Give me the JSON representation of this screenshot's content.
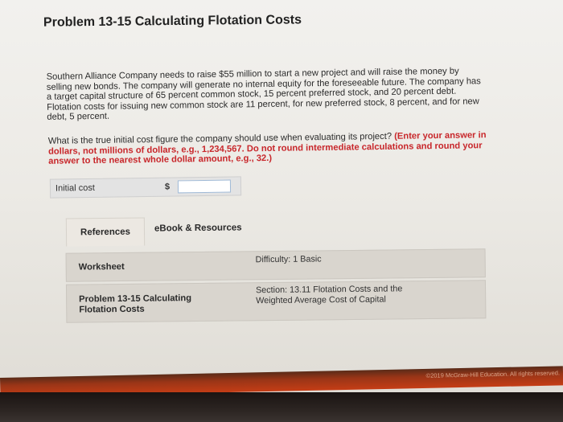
{
  "page": {
    "title": "Problem 13-15 Calculating Flotation Costs"
  },
  "problem": {
    "text": "Southern Alliance Company needs to raise $55 million to start a new project and will raise the money by selling new bonds. The company will generate no internal equity for the foreseeable future. The company has a target capital structure of 65 percent common stock, 15 percent preferred stock, and 20 percent debt. Flotation costs for issuing new common stock are 11 percent, for new preferred stock, 8 percent, and for new debt, 5 percent.",
    "question": "What is the true initial cost figure the company should use when evaluating its project?",
    "instructions": "(Enter your answer in dollars, not millions of dollars, e.g., 1,234,567. Do not round intermediate calculations and round your answer to the nearest whole dollar amount, e.g., 32.)"
  },
  "answer": {
    "label": "Initial cost",
    "currency": "$",
    "value": ""
  },
  "tabs": [
    {
      "label": "References",
      "active": true
    },
    {
      "label": "eBook & Resources",
      "active": false
    }
  ],
  "references": [
    {
      "left": "Worksheet",
      "right": "Difficulty: 1 Basic"
    },
    {
      "left": "Problem 13-15 Calculating Flotation Costs",
      "right": "Section: 13.11 Flotation Costs and the Weighted Average Cost of Capital"
    }
  ],
  "footer": {
    "copyright": "©2019 McGraw-Hill Education. All rights reserved."
  },
  "colors": {
    "instruction_red": "#c8272b",
    "footer_orange": "#c53d16"
  }
}
